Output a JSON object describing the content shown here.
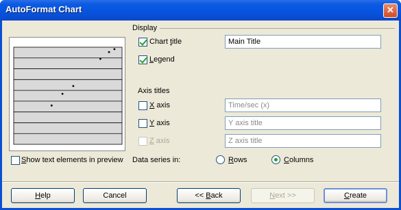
{
  "window": {
    "title": "AutoFormat Chart"
  },
  "display": {
    "group_label": "Display",
    "chart_title": {
      "label": "Chart title",
      "checked": true,
      "value": "Main Title"
    },
    "legend": {
      "label": "Legend",
      "checked": true
    }
  },
  "axis_titles": {
    "group_label": "Axis titles",
    "x": {
      "label": "X axis",
      "checked": false,
      "value": "Time/sec (x)"
    },
    "y": {
      "label": "Y axis",
      "checked": false,
      "placeholder": "Y axis title"
    },
    "z": {
      "label": "Z axis",
      "checked": false,
      "placeholder": "Z axis title",
      "disabled": true
    }
  },
  "preview": {
    "show_text_label": "Show text elements in preview",
    "checked": false
  },
  "data_series": {
    "label": "Data series in:",
    "rows_label": "Rows",
    "columns_label": "Columns",
    "selected": "Columns"
  },
  "buttons": {
    "help": "Help",
    "cancel": "Cancel",
    "back": "<< Back",
    "next": "Next >>",
    "create": "Create"
  },
  "colors": {
    "titlebar": "#0a48c9",
    "dialog_bg": "#ece9d8",
    "check_green": "#21a121"
  },
  "chart_data": {
    "type": "scatter",
    "x": [
      0.35,
      0.45,
      0.55,
      0.8,
      0.88,
      0.93
    ],
    "y": [
      0.4,
      0.52,
      0.6,
      0.88,
      0.95,
      0.98
    ]
  }
}
